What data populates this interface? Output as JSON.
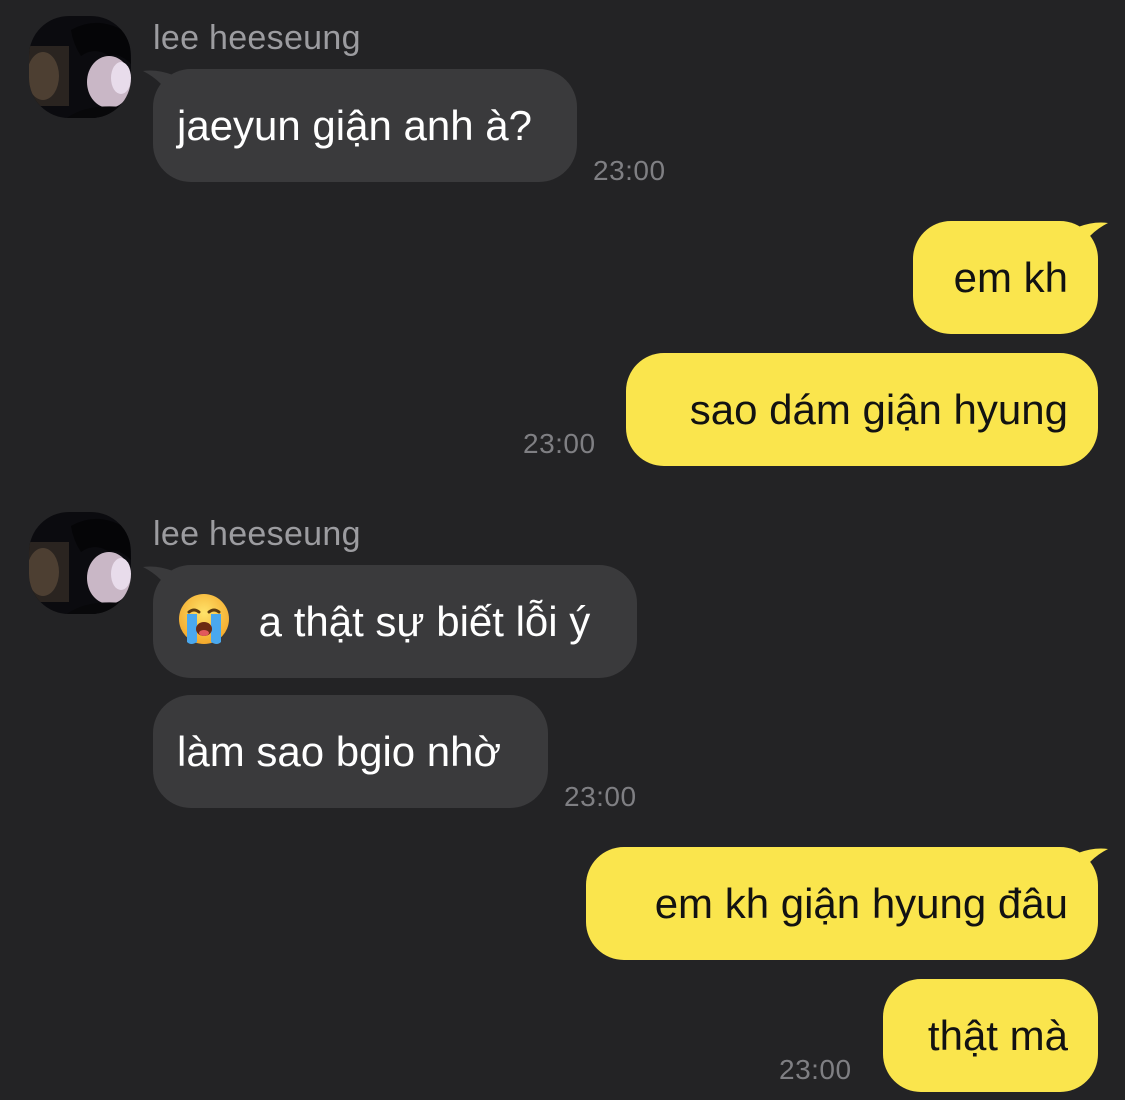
{
  "chat": {
    "messages": [
      {
        "sender": "lee heeseung",
        "text": "jaeyun giận anh à?",
        "time": "23:00"
      },
      {
        "text": "em kh"
      },
      {
        "text": "sao dám giận hyung",
        "time": "23:00"
      },
      {
        "sender": "lee heeseung",
        "text": "a thật sự biết lỗi ý",
        "icon": "loudly-crying-face-emoji"
      },
      {
        "text": "làm sao bgio nhờ",
        "time": "23:00"
      },
      {
        "text": "em kh giận hyung đâu"
      },
      {
        "text": "thật mà",
        "time": "23:00"
      }
    ]
  },
  "colors": {
    "background": "#232325",
    "incoming_bubble": "#3a3a3c",
    "outgoing_bubble": "#fae54d",
    "name_text": "#9c9ca0",
    "time_text": "#7f7f83"
  }
}
